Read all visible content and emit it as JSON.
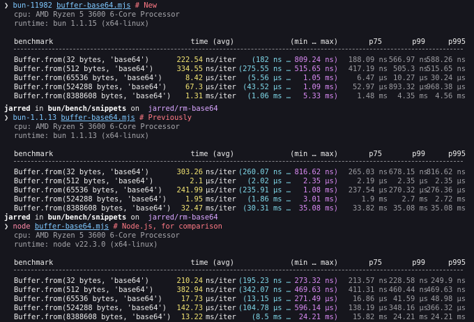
{
  "sections": [
    {
      "pre": [],
      "cmd": {
        "prompt": "❯",
        "command": "bun-11982",
        "file": "buffer-base64.mjs",
        "comment": "# New",
        "kind": "bun"
      },
      "info": [
        "cpu: AMD Ryzen 5 3600 6-Core Processor",
        "runtime: bun 1.1.15 (x64-linux)"
      ],
      "header": {
        "benchmark": "benchmark",
        "time": "time (avg)",
        "range": "(min … max)",
        "p75": "p75",
        "p99": "p99",
        "p995": "p995"
      },
      "rows": [
        {
          "name": "Buffer.from(32 bytes, 'base64')",
          "avg": "222.54",
          "avg_unit": "ns/iter",
          "min": "(182 ns …",
          "max": "809.24 ns)",
          "p75": "188.09 ns",
          "p99": "566.97 ns",
          "p995": "588.26 ns"
        },
        {
          "name": "Buffer.from(512 bytes, 'base64')",
          "avg": "334.55",
          "avg_unit": "ns/iter",
          "min": "(275.55 ns …",
          "max": "515.65 ns)",
          "p75": "417.19 ns",
          "p99": "505.3 ns",
          "p995": "515.65 ns"
        },
        {
          "name": "Buffer.from(65536 bytes, 'base64')",
          "avg": "8.42",
          "avg_unit": "µs/iter",
          "min": "(5.56 µs …",
          "max": "1.05 ms)",
          "p75": "6.47 µs",
          "p99": "10.27 µs",
          "p995": "30.24 µs"
        },
        {
          "name": "Buffer.from(524288 bytes, 'base64')",
          "avg": "67.3",
          "avg_unit": "µs/iter",
          "min": "(43.52 µs …",
          "max": "1.09 ms)",
          "p75": "52.97 µs",
          "p99": "893.32 µs",
          "p995": "968.38 µs"
        },
        {
          "name": "Buffer.from(8388608 bytes, 'base64')",
          "avg": "1.31",
          "avg_unit": "ms/iter",
          "min": "(1.06 ms …",
          "max": "5.33 ms)",
          "p75": "1.48 ms",
          "p99": "4.35 ms",
          "p995": "4.56 ms"
        }
      ]
    },
    {
      "pre": [
        {
          "user": "jarred",
          "in": "in",
          "dir": "bun/bench/snippets",
          "on": "on",
          "branch_icon": "",
          "branch": "jarred/rm-base64"
        }
      ],
      "cmd": {
        "prompt": "❯",
        "command": "bun-1.1.13",
        "file": "buffer-base64.mjs",
        "comment": "# Previously",
        "kind": "bun"
      },
      "info": [
        "cpu: AMD Ryzen 5 3600 6-Core Processor",
        "runtime: bun 1.1.13 (x64-linux)"
      ],
      "header": {
        "benchmark": "benchmark",
        "time": "time (avg)",
        "range": "(min … max)",
        "p75": "p75",
        "p99": "p99",
        "p995": "p995"
      },
      "rows": [
        {
          "name": "Buffer.from(32 bytes, 'base64')",
          "avg": "303.26",
          "avg_unit": "ns/iter",
          "min": "(260.07 ns …",
          "max": "816.62 ns)",
          "p75": "265.03 ns",
          "p99": "678.15 ns",
          "p995": "816.62 ns"
        },
        {
          "name": "Buffer.from(512 bytes, 'base64')",
          "avg": "2.1",
          "avg_unit": "µs/iter",
          "min": "(2.02 µs …",
          "max": "2.35 µs)",
          "p75": "2.19 µs",
          "p99": "2.35 µs",
          "p995": "2.35 µs"
        },
        {
          "name": "Buffer.from(65536 bytes, 'base64')",
          "avg": "241.99",
          "avg_unit": "µs/iter",
          "min": "(235.91 µs …",
          "max": "1.08 ms)",
          "p75": "237.54 µs",
          "p99": "270.32 µs",
          "p995": "276.36 µs"
        },
        {
          "name": "Buffer.from(524288 bytes, 'base64')",
          "avg": "1.95",
          "avg_unit": "ms/iter",
          "min": "(1.86 ms …",
          "max": "3.01 ms)",
          "p75": "1.9 ms",
          "p99": "2.7 ms",
          "p995": "2.72 ms"
        },
        {
          "name": "Buffer.from(8388608 bytes, 'base64')",
          "avg": "32.47",
          "avg_unit": "ms/iter",
          "min": "(30.31 ms …",
          "max": "35.08 ms)",
          "p75": "33.82 ms",
          "p99": "35.08 ms",
          "p995": "35.08 ms"
        }
      ]
    },
    {
      "pre": [
        {
          "user": "jarred",
          "in": "in",
          "dir": "bun/bench/snippets",
          "on": "on",
          "branch_icon": "",
          "branch": "jarred/rm-base64"
        }
      ],
      "cmd": {
        "prompt": "❯",
        "command": "node",
        "file": "buffer-base64.mjs",
        "comment": "# Node.js, for comparison",
        "kind": "node"
      },
      "info": [
        "cpu: AMD Ryzen 5 3600 6-Core Processor",
        "runtime: node v22.3.0 (x64-linux)"
      ],
      "header": {
        "benchmark": "benchmark",
        "time": "time (avg)",
        "range": "(min … max)",
        "p75": "p75",
        "p99": "p99",
        "p995": "p995"
      },
      "rows": [
        {
          "name": "Buffer.from(32 bytes, 'base64')",
          "avg": "210.24",
          "avg_unit": "ns/iter",
          "min": "(195.23 ns …",
          "max": "273.32 ns)",
          "p75": "213.57 ns",
          "p99": "228.58 ns",
          "p995": "249.9 ns"
        },
        {
          "name": "Buffer.from(512 bytes, 'base64')",
          "avg": "382.94",
          "avg_unit": "ns/iter",
          "min": "(342.07 ns …",
          "max": "469.63 ns)",
          "p75": "411.31 ns",
          "p99": "460.44 ns",
          "p995": "469.63 ns"
        },
        {
          "name": "Buffer.from(65536 bytes, 'base64')",
          "avg": "17.73",
          "avg_unit": "µs/iter",
          "min": "(13.15 µs …",
          "max": "271.49 µs)",
          "p75": "16.86 µs",
          "p99": "41.59 µs",
          "p995": "48.98 µs"
        },
        {
          "name": "Buffer.from(524288 bytes, 'base64')",
          "avg": "142.73",
          "avg_unit": "µs/iter",
          "min": "(104.78 µs …",
          "max": "596.14 µs)",
          "p75": "138.19 µs",
          "p99": "348.16 µs",
          "p995": "366.32 µs"
        },
        {
          "name": "Buffer.from(8388608 bytes, 'base64')",
          "avg": "13.22",
          "avg_unit": "ms/iter",
          "min": "(8.5 ms …",
          "max": "24.21 ms)",
          "p75": "15.82 ms",
          "p99": "24.21 ms",
          "p995": "24.21 ms"
        }
      ]
    }
  ]
}
